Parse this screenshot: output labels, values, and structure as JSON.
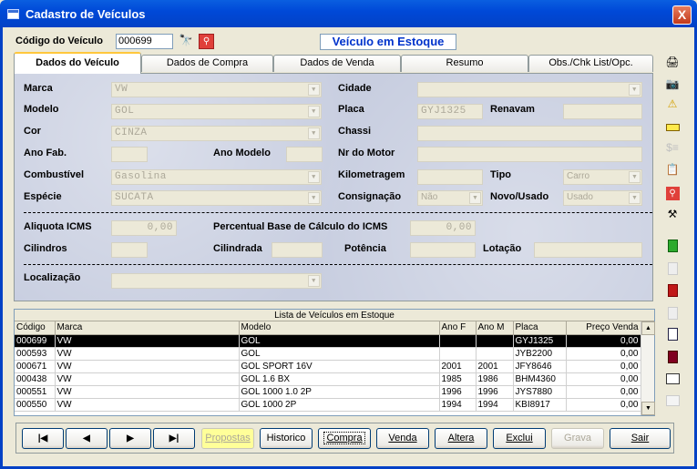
{
  "window": {
    "title": "Cadastro de Veículos",
    "close": "X"
  },
  "header": {
    "codigo_label": "Código do Veículo",
    "codigo_value": "000699",
    "status": "Veículo em Estoque"
  },
  "tabs": [
    "Dados do Veículo",
    "Dados de Compra",
    "Dados de Venda",
    "Resumo",
    "Obs./Chk List/Opc."
  ],
  "form": {
    "marca_label": "Marca",
    "marca_value": "VW",
    "modelo_label": "Modelo",
    "modelo_value": "GOL",
    "cor_label": "Cor",
    "cor_value": "CINZA",
    "anofab_label": "Ano Fab.",
    "anomodelo_label": "Ano Modelo",
    "combustivel_label": "Combustível",
    "combustivel_value": "Gasolina",
    "especie_label": "Espécie",
    "especie_value": "SUCATA",
    "cidade_label": "Cidade",
    "placa_label": "Placa",
    "placa_value": "GYJ1325",
    "renavam_label": "Renavam",
    "chassi_label": "Chassi",
    "motor_label": "Nr do Motor",
    "km_label": "Kilometragem",
    "tipo_label": "Tipo",
    "tipo_value": "Carro",
    "consignacao_label": "Consignação",
    "consignacao_value": "Não",
    "novousado_label": "Novo/Usado",
    "novousado_value": "Usado",
    "icms_label": "Aliquota ICMS",
    "icms_value": "0,00",
    "base_label": "Percentual Base de Cálculo do ICMS",
    "base_value": "0,00",
    "cilindros_label": "Cilindros",
    "cilindrada_label": "Cilindrada",
    "potencia_label": "Potência",
    "lotacao_label": "Lotação",
    "localizacao_label": "Localização"
  },
  "grid": {
    "caption": "Lista de Veículos em Estoque",
    "columns": [
      "Código",
      "Marca",
      "Modelo",
      "Ano F",
      "Ano M",
      "Placa",
      "Preço Venda"
    ],
    "rows": [
      [
        "000699",
        "VW",
        "GOL",
        "",
        "",
        "GYJ1325",
        "0,00"
      ],
      [
        "000593",
        "VW",
        "GOL",
        "",
        "",
        "JYB2200",
        "0,00"
      ],
      [
        "000671",
        "VW",
        "GOL  SPORT 16V",
        "2001",
        "2001",
        "JFY8646",
        "0,00"
      ],
      [
        "000438",
        "VW",
        "GOL 1.6 BX",
        "1985",
        "1986",
        "BHM4360",
        "0,00"
      ],
      [
        "000551",
        "VW",
        "GOL 1000 1.0 2P",
        "1996",
        "1996",
        "JYS7880",
        "0,00"
      ],
      [
        "000550",
        "VW",
        "GOL 1000 2P",
        "1994",
        "1994",
        "KBI8917",
        "0,00"
      ]
    ],
    "selected_row": 0
  },
  "buttons": {
    "propostas": "Propostas",
    "historico": "Historico",
    "compra": "Compra",
    "venda": "Venda",
    "altera": "Altera",
    "exclui": "Exclui",
    "grava": "Grava",
    "sair": "Sair"
  },
  "colors": {
    "titlebar": "#0049D8",
    "panel": "#C8CEE0",
    "selected": "#000000",
    "status_text": "#0033CC"
  }
}
